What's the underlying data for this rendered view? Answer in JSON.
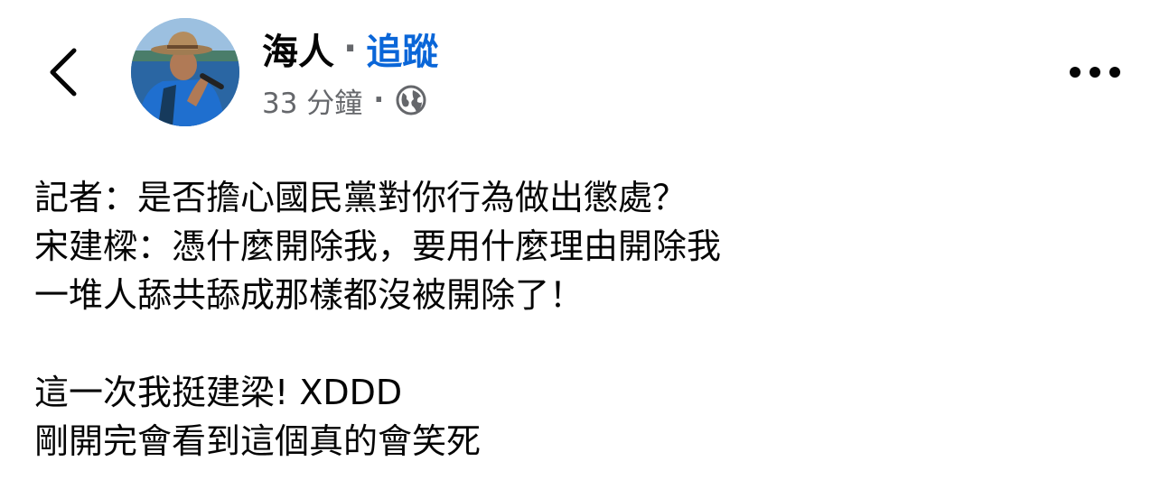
{
  "header": {
    "author_name": "海人",
    "separator": "·",
    "follow_label": "追蹤",
    "timestamp": "33 分鐘",
    "meta_separator": "·",
    "privacy_icon": "globe-icon",
    "back_icon": "chevron-left-icon",
    "more_icon": "more-horizontal-icon"
  },
  "post": {
    "lines": [
      "記者：是否擔心國民黨對你行為做出懲處？",
      "宋建樑：憑什麼開除我，要用什麼理由開除我",
      "一堆人舔共舔成那樣都沒被開除了！",
      "這一次我挺建梁! XDDD",
      "剛開完會看到這個真的會笑死"
    ]
  },
  "colors": {
    "text": "#050505",
    "secondary": "#65676b",
    "link": "#0a66d8",
    "background": "#ffffff"
  }
}
